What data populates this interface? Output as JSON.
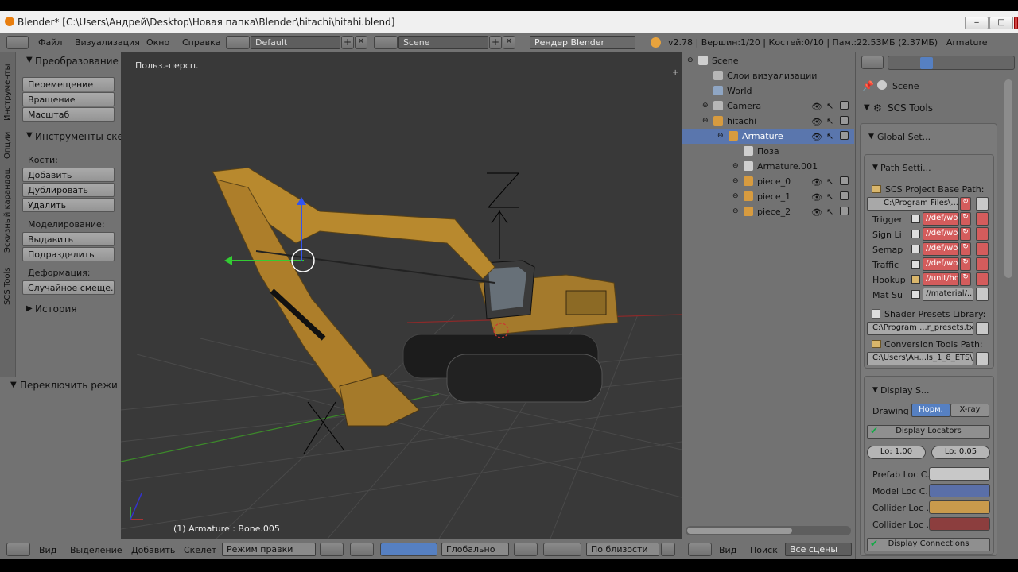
{
  "title": "Blender* [C:\\Users\\Андрей\\Desktop\\Новая папка\\Blender\\hitachi\\hitahi.blend]",
  "menu": {
    "file": "Файл",
    "render": "Визуализация",
    "window": "Окно",
    "help": "Справка"
  },
  "header": {
    "layout": "Default",
    "scene": "Scene",
    "engine": "Рендер Blender",
    "stats": "v2.78 | Вершин:1/20 | Костей:0/10 | Пам.:22.53МБ (2.37МБ) | Armature"
  },
  "left_tabs": [
    "Инструменты",
    "Опции",
    "Эскизный карандаш",
    "SCS Tools"
  ],
  "tools": {
    "transform_title": "Преобразование",
    "translate": "Перемещение",
    "rotate": "Вращение",
    "scale": "Масштаб",
    "skeleton_title": "Инструменты скел",
    "bones_label": "Кости:",
    "add": "Добавить",
    "duplicate": "Дублировать",
    "delete": "Удалить",
    "modeling_label": "Моделирование:",
    "extrude": "Выдавить",
    "subdivide": "Подразделить",
    "deform_label": "Деформация:",
    "random_shift": "Случайное смеще...",
    "history": "История",
    "toggle_mode": "Переключить режи п"
  },
  "viewport": {
    "label": "Польз.-персп.",
    "status": "(1) Armature : Bone.005"
  },
  "vp_header": {
    "view": "Вид",
    "select": "Выделение",
    "add": "Добавить",
    "armature": "Скелет",
    "mode": "Режим правки",
    "orientation": "Глобально",
    "snap": "По близости"
  },
  "outliner": [
    {
      "label": "Scene",
      "indent": 0
    },
    {
      "label": "Слои визуализации",
      "indent": 1
    },
    {
      "label": "World",
      "indent": 1
    },
    {
      "label": "Camera",
      "indent": 1
    },
    {
      "label": "hitachi",
      "indent": 1
    },
    {
      "label": "Armature",
      "indent": 2
    },
    {
      "label": "Поза",
      "indent": 3
    },
    {
      "label": "Armature.001",
      "indent": 3
    },
    {
      "label": "piece_0",
      "indent": 3
    },
    {
      "label": "piece_1",
      "indent": 3
    },
    {
      "label": "piece_2",
      "indent": 3
    }
  ],
  "outliner_header": {
    "view": "Вид",
    "search": "Поиск",
    "all_scenes": "Все сцены"
  },
  "props": {
    "scene": "Scene",
    "scs_tools": "SCS Tools",
    "global_settings": "Global Set...",
    "path_settings": "Path Setti...",
    "base_path_label": "SCS Project Base Path:",
    "base_path": "C:\\Program Files\\...",
    "paths": [
      {
        "label": "Trigger",
        "value": "//def/wor"
      },
      {
        "label": "Sign Li",
        "value": "//def/wor"
      },
      {
        "label": "Semap",
        "value": "//def/wor"
      },
      {
        "label": "Traffic",
        "value": "//def/wor"
      },
      {
        "label": "Hookup",
        "value": "//unit/hook..."
      },
      {
        "label": "Mat Su",
        "value": "//material/..."
      }
    ],
    "shader_label": "Shader Presets Library:",
    "shader_path": "C:\\Program ...r_presets.txt",
    "conv_label": "Conversion Tools Path:",
    "conv_path": "C:\\Users\\Ан...ls_1_8_ETS\\",
    "display_settings": "Display S...",
    "drawing": "Drawing",
    "normal": "Норм.",
    "xray": "X-ray",
    "display_locators": "Display Locators",
    "loc1": "Lo: 1.00",
    "loc2": "Lo: 0.05",
    "colors": [
      {
        "label": "Prefab Loc C...",
        "color": "#c8c8c8"
      },
      {
        "label": "Model Loc C...",
        "color": "#5a6fa8"
      },
      {
        "label": "Collider Loc ...",
        "color": "#c99a4c"
      },
      {
        "label": "Collider Loc ...",
        "color": "#8c3e3e"
      }
    ],
    "display_connections": "Display Connections"
  }
}
